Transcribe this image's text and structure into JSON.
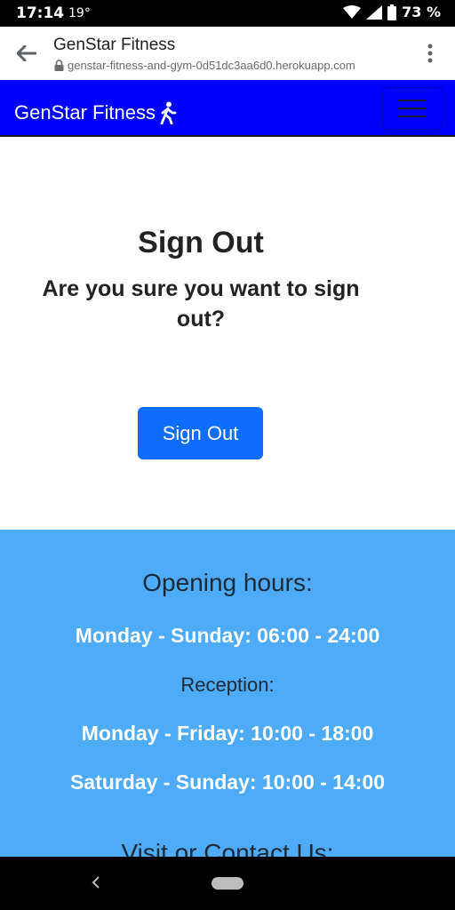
{
  "status_bar": {
    "time": "17:14",
    "temperature": "19°",
    "battery": "73 %",
    "icons": [
      "wifi-icon",
      "signal-icon",
      "battery-icon"
    ]
  },
  "browser": {
    "page_title": "GenStar Fitness",
    "url": "genstar-fitness-and-gym-0d51dc3aa6d0.herokuapp.com"
  },
  "navbar": {
    "brand": "GenStar Fitness",
    "brand_icon": "walking-person-icon",
    "background": "#0000ff"
  },
  "main": {
    "title": "Sign Out",
    "question": "Are you sure you want to sign out?",
    "button_label": "Sign Out",
    "button_color": "#0d6efd"
  },
  "footer": {
    "background": "#4dabf7",
    "opening_heading": "Opening hours:",
    "opening_hours": "Monday - Sunday: 06:00 - 24:00",
    "reception_heading": "Reception:",
    "reception_weekdays": "Monday - Friday: 10:00 - 18:00",
    "reception_weekend": "Saturday - Sunday: 10:00 - 14:00",
    "contact_heading": "Visit or Contact Us:"
  }
}
